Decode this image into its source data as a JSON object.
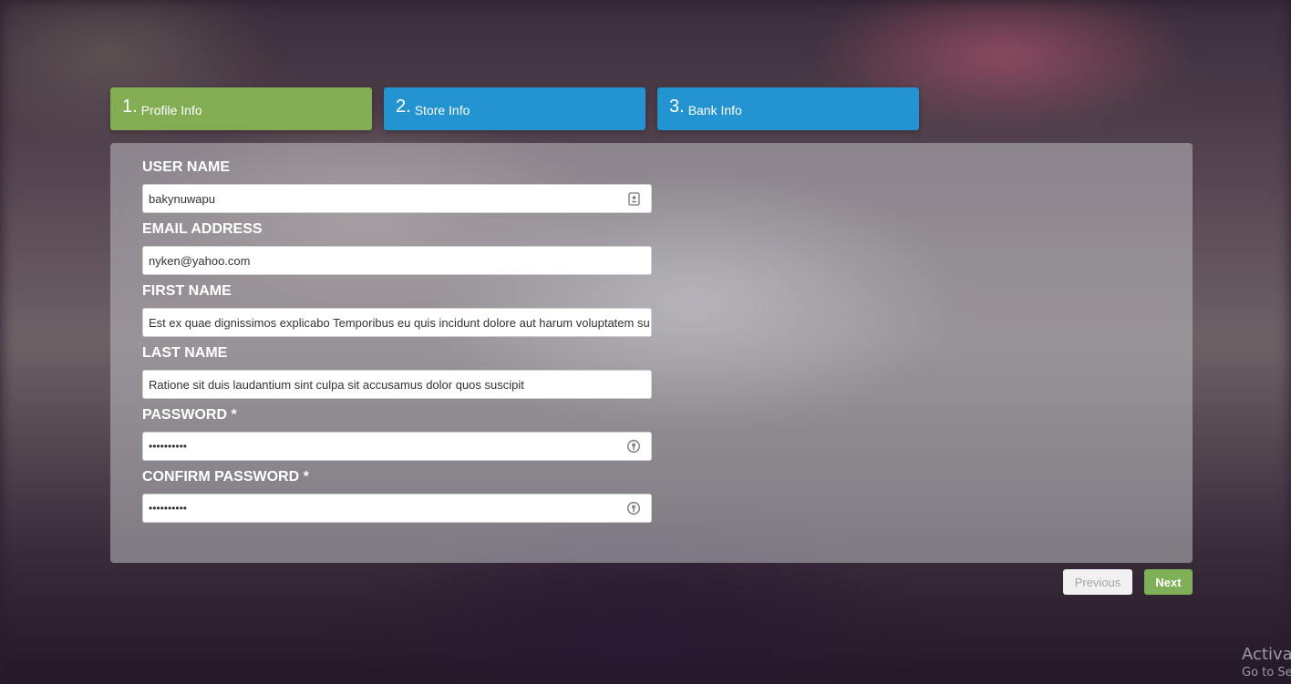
{
  "colors": {
    "step_active": "#83ad52",
    "step_inactive": "#2394cf",
    "next_button": "#7faf56",
    "previous_button": "#f1f1f1"
  },
  "steps": [
    {
      "number": "1.",
      "label": "Profile Info",
      "state": "active"
    },
    {
      "number": "2.",
      "label": "Store Info",
      "state": "inactive"
    },
    {
      "number": "3.",
      "label": "Bank Info",
      "state": "inactive"
    }
  ],
  "form": {
    "username": {
      "label": "USER NAME",
      "value": "bakynuwapu",
      "icon": "contact-card-icon"
    },
    "email": {
      "label": "EMAIL ADDRESS",
      "value": "nyken@yahoo.com"
    },
    "first_name": {
      "label": "FIRST NAME",
      "value": "Est ex quae dignissimos explicabo Temporibus eu quis incidunt dolore aut harum voluptatem sunt"
    },
    "last_name": {
      "label": "LAST NAME",
      "value": "Ratione sit duis laudantium sint culpa sit accusamus dolor quos suscipit"
    },
    "password": {
      "label": "PASSWORD *",
      "value": "••••••••••",
      "icon": "key-icon"
    },
    "confirm_password": {
      "label": "CONFIRM PASSWORD *",
      "value": "••••••••••",
      "icon": "key-icon"
    }
  },
  "buttons": {
    "previous": "Previous",
    "next": "Next"
  },
  "watermark": {
    "line1": "Activa",
    "line2": "Go to Se"
  }
}
